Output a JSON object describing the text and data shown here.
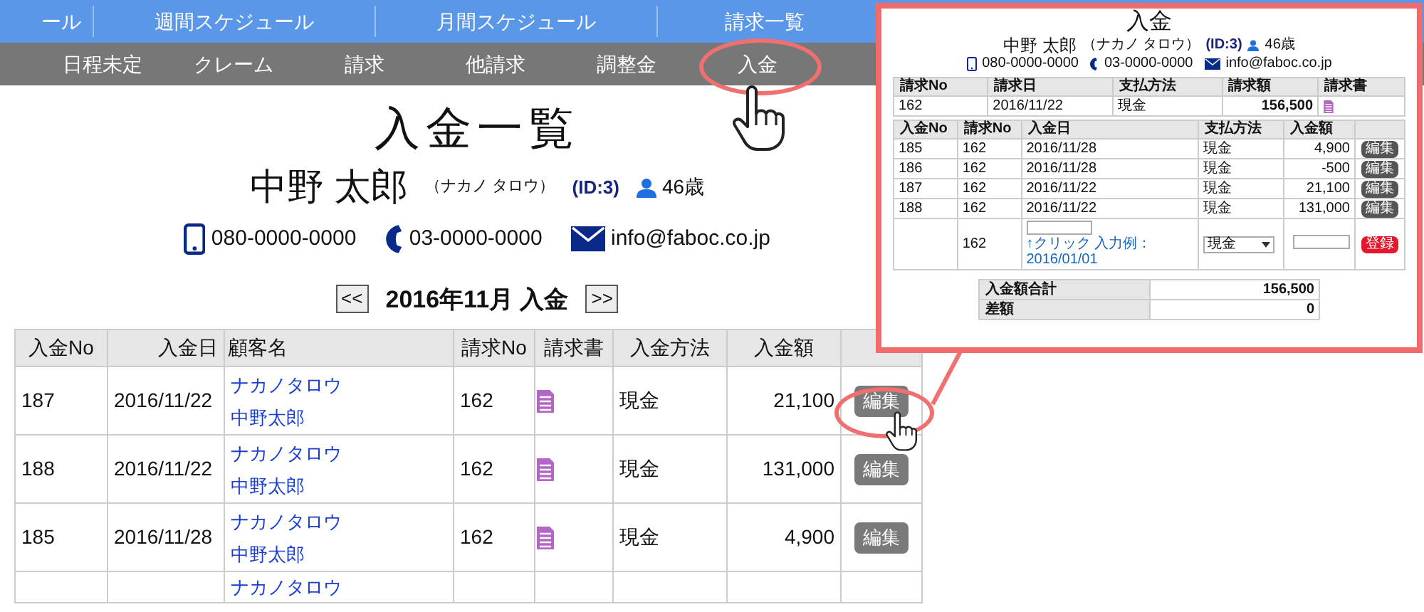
{
  "top_nav": [
    {
      "label": "ール"
    },
    {
      "label": "週間スケジュール"
    },
    {
      "label": "月間スケジュール"
    },
    {
      "label": "請求一覧"
    }
  ],
  "sub_nav": [
    {
      "label": "日程未定"
    },
    {
      "label": "クレーム"
    },
    {
      "label": "請求"
    },
    {
      "label": "他請求"
    },
    {
      "label": "調整金"
    },
    {
      "label": "入金"
    }
  ],
  "page_title": "入金一覧",
  "customer": {
    "name": "中野 太郎",
    "kana": "（ナカノ タロウ）",
    "id": "(ID:3)",
    "age": "46歳",
    "mobile": "080-0000-0000",
    "phone": "03-0000-0000",
    "email": "info@faboc.co.jp"
  },
  "month_nav": {
    "prev": "<<",
    "title": "2016年11月 入金",
    "next": ">>"
  },
  "table": {
    "columns": [
      "入金No",
      "入金日",
      "顧客名",
      "請求No",
      "請求書",
      "入金方法",
      "入金額"
    ],
    "rows": [
      {
        "no": "187",
        "date": "2016/11/22",
        "kana": "ナカノタロウ",
        "name": "中野太郎",
        "invoice_no": "162",
        "method": "現金",
        "amount": "21,100",
        "edit": "編集"
      },
      {
        "no": "188",
        "date": "2016/11/22",
        "kana": "ナカノタロウ",
        "name": "中野太郎",
        "invoice_no": "162",
        "method": "現金",
        "amount": "131,000",
        "edit": "編集"
      },
      {
        "no": "185",
        "date": "2016/11/28",
        "kana": "ナカノタロウ",
        "name": "中野太郎",
        "invoice_no": "162",
        "method": "現金",
        "amount": "4,900",
        "edit": "編集"
      },
      {
        "kana": "ナカノタロウ"
      }
    ]
  },
  "inset": {
    "title": "入金",
    "customer": {
      "name": "中野 太郎",
      "kana": "（ナカノ タロウ）",
      "id": "(ID:3)",
      "age": "46歳",
      "mobile": "080-0000-0000",
      "phone": "03-0000-0000",
      "email": "info@faboc.co.jp"
    },
    "invoice_table": {
      "columns": [
        "請求No",
        "請求日",
        "支払方法",
        "請求額",
        "請求書"
      ],
      "row": {
        "no": "162",
        "date": "2016/11/22",
        "method": "現金",
        "amount": "156,500"
      }
    },
    "payment_table": {
      "columns": [
        "入金No",
        "請求No",
        "入金日",
        "支払方法",
        "入金額"
      ],
      "rows": [
        {
          "no": "185",
          "invoice_no": "162",
          "date": "2016/11/28",
          "method": "現金",
          "amount": "4,900",
          "edit": "編集"
        },
        {
          "no": "186",
          "invoice_no": "162",
          "date": "2016/11/28",
          "method": "現金",
          "amount": "-500",
          "edit": "編集"
        },
        {
          "no": "187",
          "invoice_no": "162",
          "date": "2016/11/22",
          "method": "現金",
          "amount": "21,100",
          "edit": "編集"
        },
        {
          "no": "188",
          "invoice_no": "162",
          "date": "2016/11/22",
          "method": "現金",
          "amount": "131,000",
          "edit": "編集"
        }
      ],
      "new_row": {
        "invoice_no": "162",
        "hint": "↑クリック 入力例：2016/01/01",
        "method": "現金",
        "register": "登録"
      }
    },
    "summary": [
      {
        "label": "入金額合計",
        "value": "156,500"
      },
      {
        "label": "差額",
        "value": "0"
      }
    ]
  }
}
